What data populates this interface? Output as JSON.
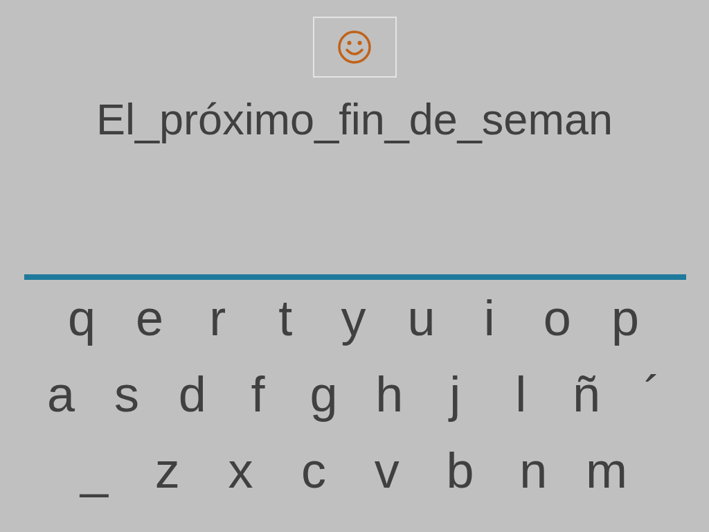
{
  "sentence": "El_próximo_fin_de_seman",
  "keyboard": {
    "rows": [
      [
        "q",
        "e",
        "r",
        "t",
        "y",
        "u",
        "i",
        "o",
        "p"
      ],
      [
        "a",
        "s",
        "d",
        "f",
        "g",
        "h",
        "j",
        "l",
        "ñ",
        "´"
      ],
      [
        "_",
        "z",
        "x",
        "c",
        "v",
        "b",
        "n",
        "m"
      ]
    ]
  }
}
